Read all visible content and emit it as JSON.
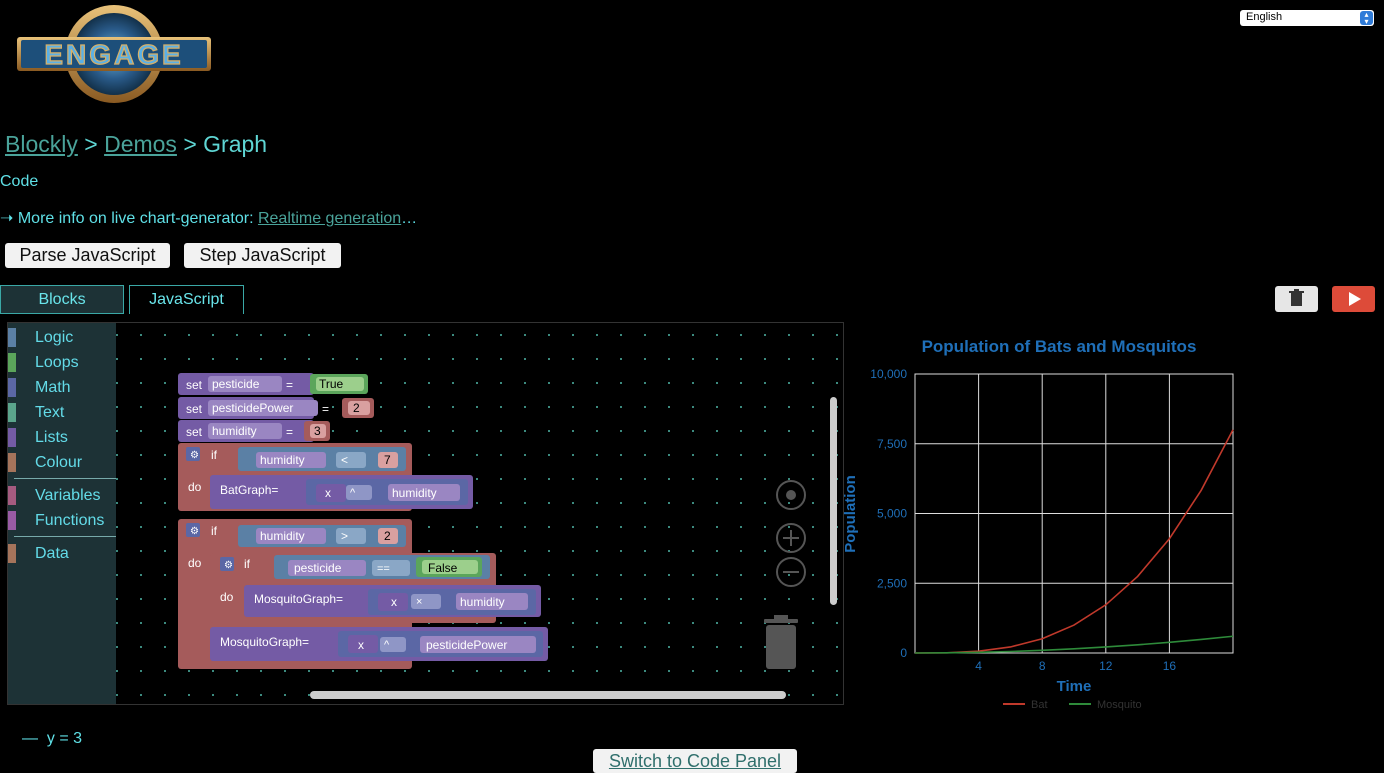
{
  "logo": {
    "text": "ENGAGE"
  },
  "language": {
    "selected": "English"
  },
  "breadcrumb": {
    "part1": "Blockly",
    "sep1": " > ",
    "part2": "Demos",
    "sep2": " > ",
    "current": "Graph"
  },
  "code_label": "Code",
  "info": {
    "arrow": "➝",
    "prefix": " More info on live chart-generator: ",
    "link": "Realtime generation",
    "suffix": "…"
  },
  "buttons": {
    "parse": "Parse JavaScript",
    "step": "Step JavaScript",
    "switch": "Switch to Code Panel"
  },
  "tabs": {
    "blocks": "Blocks",
    "javascript": "JavaScript"
  },
  "toolbox": {
    "categories": [
      {
        "label": "Logic",
        "color": "#5b80a5"
      },
      {
        "label": "Loops",
        "color": "#5ba55b"
      },
      {
        "label": "Math",
        "color": "#5b67a5"
      },
      {
        "label": "Text",
        "color": "#5ba58c"
      },
      {
        "label": "Lists",
        "color": "#745ba5"
      },
      {
        "label": "Colour",
        "color": "#a5745b"
      },
      {
        "label": "Variables",
        "color": "#a55b80"
      },
      {
        "label": "Functions",
        "color": "#995ba5"
      },
      {
        "label": "Data",
        "color": "#a5745b"
      }
    ]
  },
  "blocks": {
    "set": "set",
    "eq": "=",
    "if": "if",
    "do": "do",
    "v_pesticide": "pesticide",
    "v_pesticidePower": "pesticidePower",
    "v_humidity": "humidity",
    "true": "True",
    "false": "False",
    "n2": "2",
    "n3": "3",
    "n7": "7",
    "lt": "<",
    "gt": ">",
    "eqeq": "==",
    "pow": "^",
    "mul": "×",
    "x": "x",
    "bat": "BatGraph=",
    "mosq": "MosquitoGraph="
  },
  "colors": {
    "logic": "#5b80a5",
    "math": "#5b67a5",
    "variables": "#a55b5b",
    "procedures": "#745ba5",
    "bool": "#5ba55b"
  },
  "chart_data": {
    "type": "line",
    "title": "Population of Bats and Mosquitos",
    "xlabel": "Time",
    "ylabel": "Population",
    "xlim": [
      0,
      20
    ],
    "ylim": [
      0,
      10000
    ],
    "x_ticks": [
      "4",
      "8",
      "12",
      "16"
    ],
    "y_ticks": [
      "0",
      "2,500",
      "5,000",
      "7,500",
      "10,000"
    ],
    "series": [
      {
        "name": "Bat",
        "color": "#c0392b",
        "x": [
          0,
          2,
          4,
          6,
          8,
          10,
          12,
          14,
          16,
          18,
          20
        ],
        "values": [
          0,
          8,
          64,
          216,
          512,
          1000,
          1728,
          2744,
          4096,
          5832,
          8000
        ]
      },
      {
        "name": "Mosquito",
        "color": "#2e8b3a",
        "x": [
          0,
          2,
          4,
          6,
          8,
          10,
          12,
          14,
          16,
          18,
          20
        ],
        "values": [
          0,
          6,
          24,
          54,
          96,
          150,
          216,
          294,
          384,
          486,
          600
        ]
      }
    ],
    "legend_position": "bottom",
    "grid": true
  },
  "status": {
    "dash": "—",
    "text": "y = 3"
  }
}
